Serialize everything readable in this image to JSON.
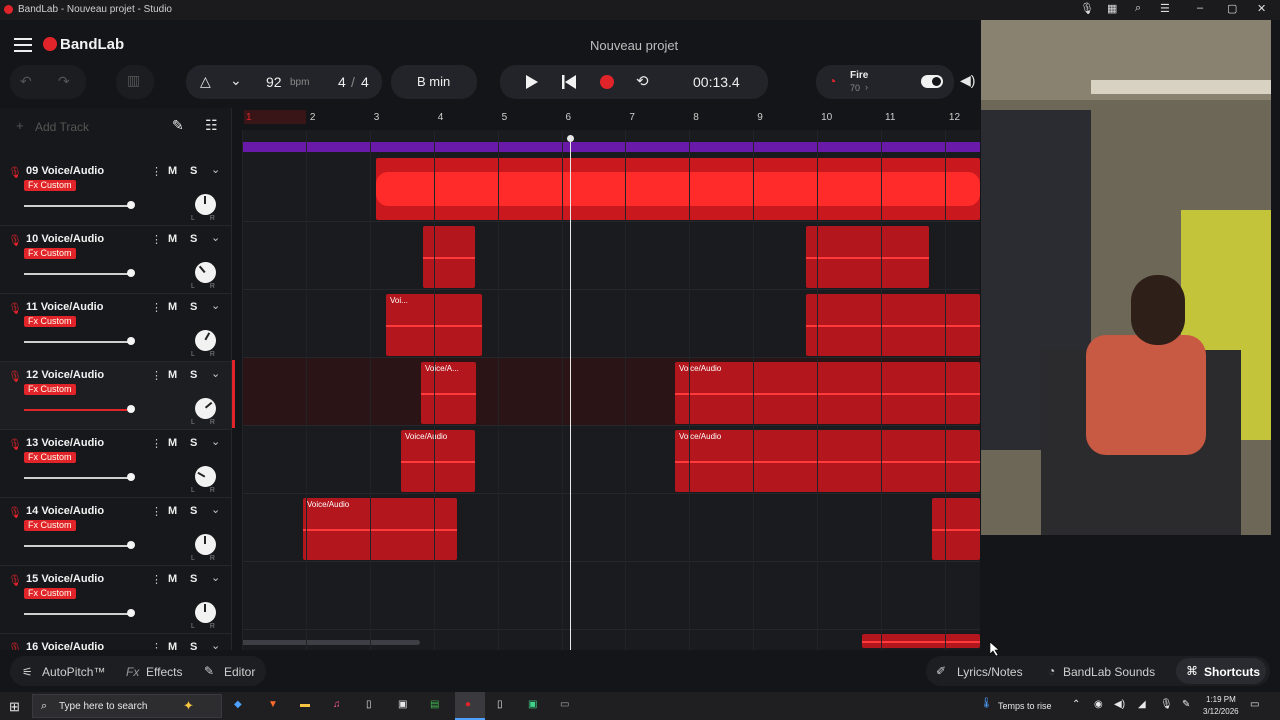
{
  "window": {
    "title": "BandLab - Nouveau projet - Studio",
    "controls": [
      "–",
      "▢",
      "✕"
    ]
  },
  "header": {
    "brand": "BandLab",
    "project_title": "Nouveau projet",
    "tempo": "92",
    "tempo_unit": "bpm",
    "time_sig_num": "4",
    "time_sig_sep": "/",
    "time_sig_den": "4",
    "key": "B min",
    "time": "00:13.4",
    "preset_name": "Fire",
    "preset_value": "70",
    "preset_chevron": "›"
  },
  "left_panel": {
    "add_track": "Add Track"
  },
  "ruler": {
    "bars": [
      "1",
      "2",
      "3",
      "4",
      "5",
      "6",
      "7",
      "8",
      "9",
      "10",
      "11",
      "12"
    ]
  },
  "tracks": [
    {
      "num": "09",
      "type": "Voice/Audio",
      "fx": "Fx Custom",
      "m": "M",
      "s": "S",
      "selected": false
    },
    {
      "num": "10",
      "type": "Voice/Audio",
      "fx": "Fx Custom",
      "m": "M",
      "s": "S",
      "selected": false
    },
    {
      "num": "11",
      "type": "Voice/Audio",
      "fx": "Fx Custom",
      "m": "M",
      "s": "S",
      "selected": false
    },
    {
      "num": "12",
      "type": "Voice/Audio",
      "fx": "Fx Custom",
      "m": "M",
      "s": "S",
      "selected": true
    },
    {
      "num": "13",
      "type": "Voice/Audio",
      "fx": "Fx Custom",
      "m": "M",
      "s": "S",
      "selected": false
    },
    {
      "num": "14",
      "type": "Voice/Audio",
      "fx": "Fx Custom",
      "m": "M",
      "s": "S",
      "selected": false
    },
    {
      "num": "15",
      "type": "Voice/Audio",
      "fx": "Fx Custom",
      "m": "M",
      "s": "S",
      "selected": false
    },
    {
      "num": "16",
      "type": "Voice/Audio",
      "fx": "",
      "m": "M",
      "s": "S",
      "selected": false
    }
  ],
  "track_labels": {
    "l": "L",
    "r": "R",
    "dots": "⋮",
    "chev": "⌄"
  },
  "clips": {
    "t11a": "Voi...",
    "t12a": "Voice/A...",
    "t12b": "Voice/Audio",
    "t13a": "Voice/Audio",
    "t13b": "Voice/Audio",
    "t14a": "Voice/Audio"
  },
  "bottom": {
    "autopitch": "AutoPitch™",
    "effects": "Effects",
    "editor": "Editor",
    "lyrics": "Lyrics/Notes",
    "sounds": "BandLab Sounds",
    "shortcuts": "Shortcuts"
  },
  "taskbar": {
    "search": "Type here to search",
    "weather": "Temps to rise",
    "time": "1:19 PM",
    "date": "3/12/2026"
  },
  "colors": {
    "accent": "#e0242a",
    "clip": "#b3161c",
    "bg": "#141518"
  }
}
